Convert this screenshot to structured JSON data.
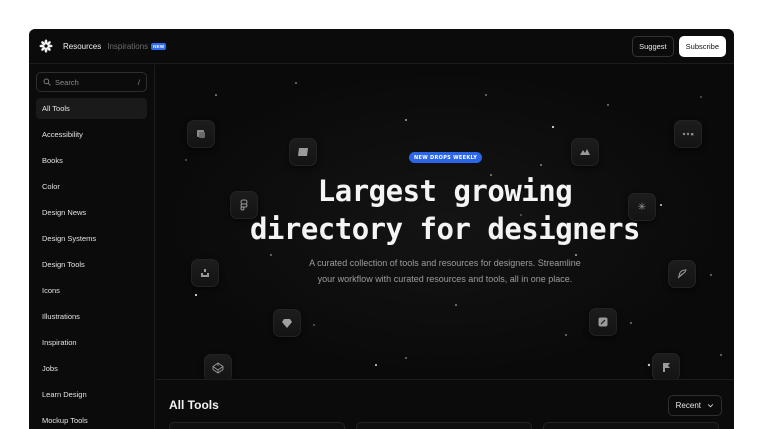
{
  "topbar": {
    "nav_resources": "Resources",
    "nav_inspirations": "Inspirations",
    "new_badge": "NEW",
    "suggest_label": "Suggest",
    "subscribe_label": "Subscribe"
  },
  "sidebar": {
    "search_placeholder": "Search",
    "search_shortcut": "/",
    "items": [
      {
        "label": "All Tools",
        "active": true
      },
      {
        "label": "Accessibility"
      },
      {
        "label": "Books"
      },
      {
        "label": "Color"
      },
      {
        "label": "Design News"
      },
      {
        "label": "Design Systems"
      },
      {
        "label": "Design Tools"
      },
      {
        "label": "Icons"
      },
      {
        "label": "Illustrations"
      },
      {
        "label": "Inspiration"
      },
      {
        "label": "Jobs"
      },
      {
        "label": "Learn Design"
      },
      {
        "label": "Mockup Tools"
      }
    ]
  },
  "hero": {
    "badge": "NEW DROPS WEEKLY",
    "title_line1": "Largest growing",
    "title_line2": "directory for designers",
    "subtitle_line1": "A curated collection of tools and resources for designers. Streamline",
    "subtitle_line2": "your workflow with curated resources and tools, all in one place."
  },
  "main": {
    "section_title": "All Tools",
    "sort_label": "Recent"
  },
  "colors": {
    "background": "#0b0b0b",
    "accent_blue": "#2c66e8",
    "text_primary": "#f4f4f4",
    "text_muted": "#9d9d9d"
  }
}
